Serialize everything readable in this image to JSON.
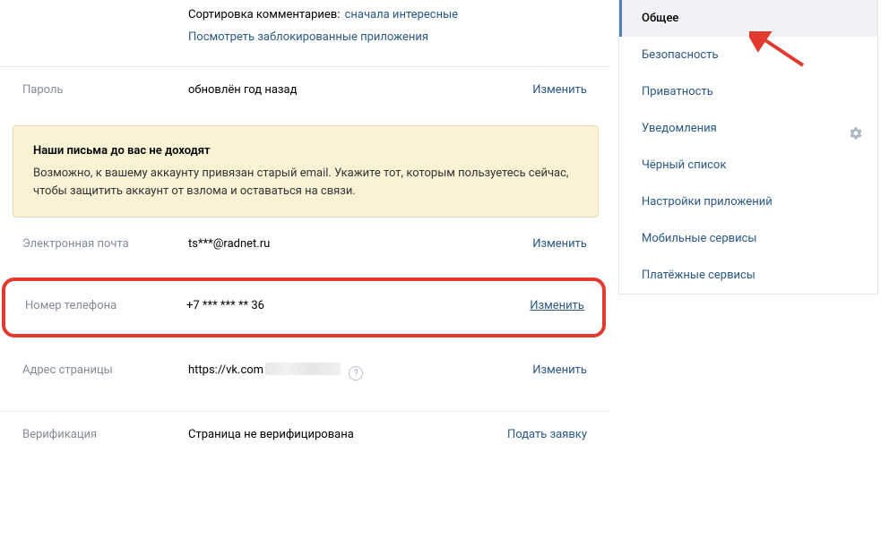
{
  "top_links": {
    "sort_label": "Сортировка комментариев:",
    "sort_value": "сначала интересные",
    "blocked_apps": "Посмотреть заблокированные приложения"
  },
  "password": {
    "label": "Пароль",
    "value": "обновлён год назад",
    "action": "Изменить"
  },
  "warning": {
    "title": "Наши письма до вас не доходят",
    "text": "Возможно, к вашему аккаунту привязан старый email. Укажите тот, которым пользуетесь сейчас, чтобы защитить аккаунт от взлома и оставаться на связи."
  },
  "email": {
    "label": "Электронная почта",
    "value": "ts***@radnet.ru",
    "action": "Изменить"
  },
  "phone": {
    "label": "Номер телефона",
    "value": "+7 *** *** ** 36",
    "action": "Изменить"
  },
  "page_address": {
    "label": "Адрес страницы",
    "value": "https://vk.com",
    "action": "Изменить"
  },
  "verification": {
    "label": "Верификация",
    "value": "Страница не верифицирована",
    "action": "Подать заявку"
  },
  "sidebar": {
    "items": [
      "Общее",
      "Безопасность",
      "Приватность",
      "Уведомления",
      "Чёрный список",
      "Настройки приложений",
      "Мобильные сервисы",
      "Платёжные сервисы"
    ]
  }
}
